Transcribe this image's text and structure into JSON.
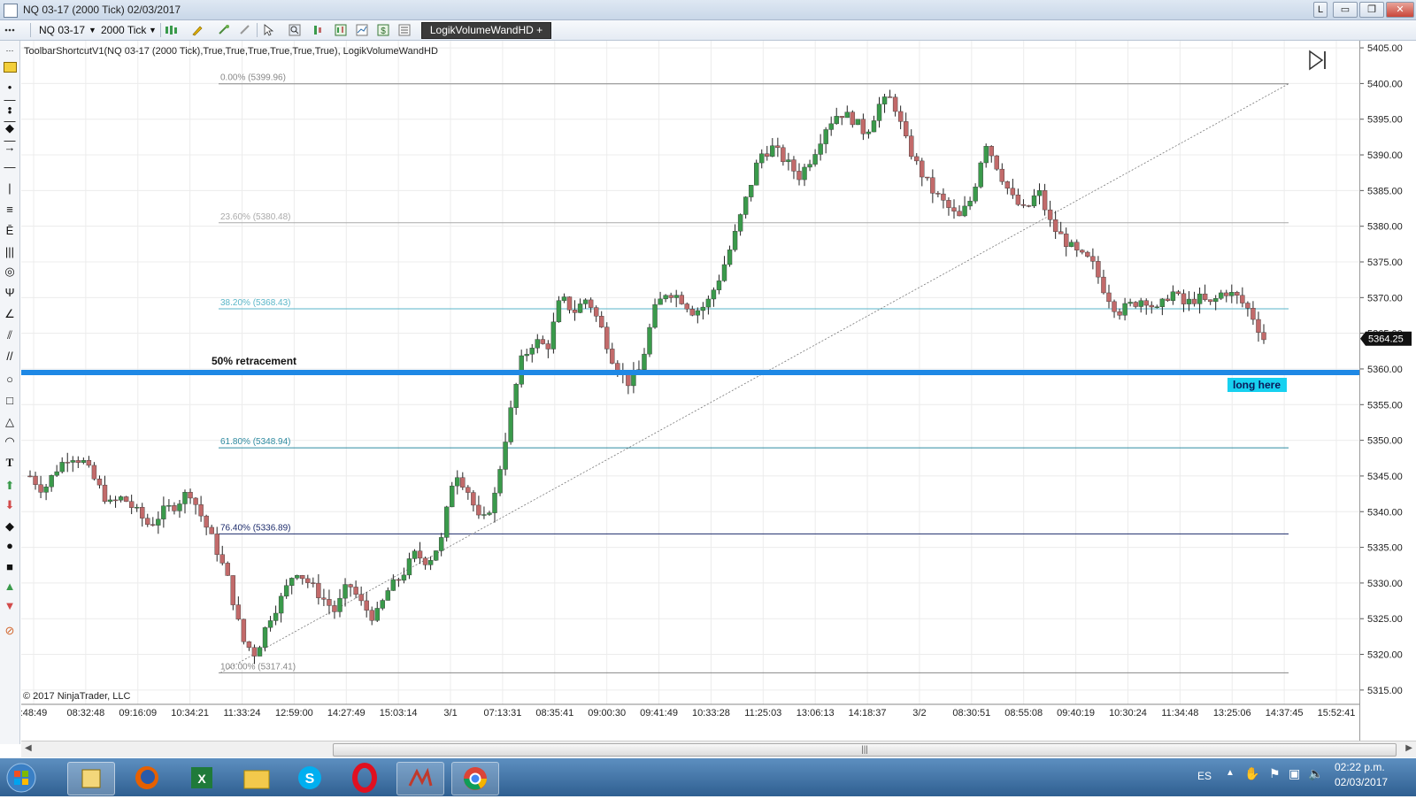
{
  "window": {
    "title": "NQ 03-17 (2000 Tick)  02/03/2017",
    "btn_l": "L",
    "btn_min": "▭",
    "btn_restore": "❐",
    "btn_close": "✕"
  },
  "toolbar": {
    "instrument": "NQ 03-17",
    "period": "2000 Tick",
    "indicator_button": "LogikVolumeWandHD +"
  },
  "chart_header": "ToolbarShortcutV1(NQ 03-17 (2000 Tick),True,True,True,True,True,True), LogikVolumeWandHD",
  "copyright": "© 2017 NinjaTrader, LLC",
  "annotations": {
    "retracement_label": "50% retracement",
    "long_label": "long here"
  },
  "fib_levels": [
    {
      "label": "0.00% (5399.96)",
      "price": 5399.96,
      "color": "#888888"
    },
    {
      "label": "23.60% (5380.48)",
      "price": 5380.48,
      "color": "#aaaaaa"
    },
    {
      "label": "38.20% (5368.43)",
      "price": 5368.43,
      "color": "#5ab6c8"
    },
    {
      "label": "61.80% (5348.94)",
      "price": 5348.94,
      "color": "#2e8aa0"
    },
    {
      "label": "76.40% (5336.89)",
      "price": 5336.89,
      "color": "#1c2b6b"
    },
    {
      "label": "100.00% (5317.41)",
      "price": 5317.41,
      "color": "#888888"
    }
  ],
  "price_axis": {
    "ticks": [
      "5405.00",
      "5400.00",
      "5395.00",
      "5390.00",
      "5385.00",
      "5380.00",
      "5375.00",
      "5370.00",
      "5365.00",
      "5360.00",
      "5355.00",
      "5350.00",
      "5345.00",
      "5340.00",
      "5335.00",
      "5330.00",
      "5325.00",
      "5320.00",
      "5315.00"
    ],
    "current_price": "5364.25",
    "retracement_price": 5359.5
  },
  "time_axis": [
    ":48:49",
    "08:32:48",
    "09:16:09",
    "10:34:21",
    "11:33:24",
    "12:59:00",
    "14:27:49",
    "15:03:14",
    "3/1",
    "07:13:31",
    "08:35:41",
    "09:00:30",
    "09:41:49",
    "10:33:28",
    "11:25:03",
    "13:06:13",
    "14:18:37",
    "3/2",
    "08:30:51",
    "08:55:08",
    "09:40:19",
    "10:30:24",
    "11:34:48",
    "13:25:06",
    "14:37:45",
    "15:52:41"
  ],
  "chart_data": {
    "type": "candlestick",
    "instrument": "NQ 03-17",
    "period": "2000 Tick",
    "ylim": [
      5313.0,
      5406.0
    ],
    "close_path": [
      5345,
      5343,
      5346,
      5348,
      5347,
      5344,
      5341,
      5342,
      5340,
      5338,
      5340,
      5341,
      5343,
      5339,
      5335,
      5330,
      5322,
      5320,
      5325,
      5328,
      5332,
      5330,
      5328,
      5326,
      5330,
      5327,
      5325,
      5329,
      5331,
      5334,
      5333,
      5336,
      5346,
      5343,
      5338,
      5342,
      5352,
      5361,
      5364,
      5363,
      5370,
      5368,
      5370,
      5366,
      5361,
      5358,
      5360,
      5368,
      5371,
      5370,
      5368,
      5369,
      5373,
      5378,
      5384,
      5390,
      5391,
      5389,
      5387,
      5390,
      5394,
      5396,
      5395,
      5393,
      5397,
      5398,
      5392,
      5388,
      5385,
      5383,
      5381,
      5384,
      5392,
      5388,
      5384,
      5382,
      5385,
      5380,
      5378,
      5376,
      5375,
      5371,
      5368,
      5369,
      5370,
      5368,
      5371,
      5369,
      5370,
      5369,
      5371,
      5370,
      5368,
      5364.25
    ],
    "current_price": 5364.25,
    "fib_high": 5399.96,
    "fib_low": 5317.41
  },
  "taskbar": {
    "lang": "ES",
    "time": "02:22 p.m.",
    "date": "02/03/2017"
  },
  "colors": {
    "up_candle": "#3a9a4b",
    "down_candle": "#c26a6a",
    "retracement_line": "#1e88e5",
    "long_badge": "#17d1f0"
  }
}
